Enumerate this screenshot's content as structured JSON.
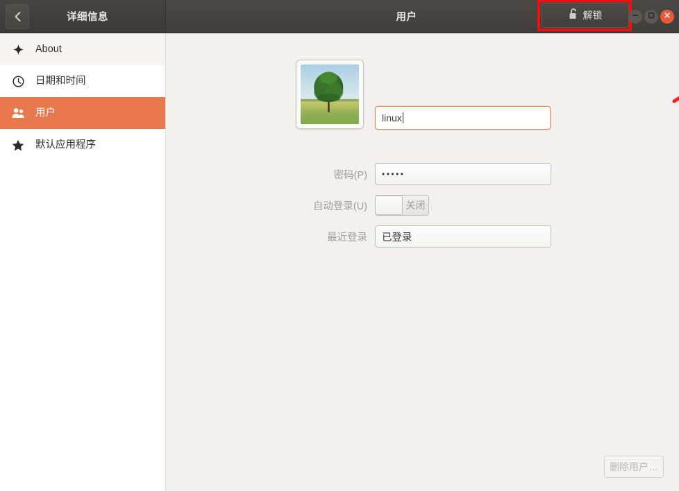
{
  "window": {
    "sidebar_title": "详细信息",
    "main_title": "用户",
    "back_icon": "chevron-left-icon",
    "unlock_label": "解锁",
    "unlock_icon": "open-padlock-icon",
    "minimize_icon": "minimize-icon",
    "maximize_icon": "maximize-icon",
    "close_icon": "close-icon"
  },
  "sidebar": {
    "items": [
      {
        "label": "About",
        "icon": "sparkle-icon",
        "selected": false
      },
      {
        "label": "日期和时间",
        "icon": "clock-icon",
        "selected": false
      },
      {
        "label": "用户",
        "icon": "users-icon",
        "selected": true
      },
      {
        "label": "默认应用程序",
        "icon": "star-icon",
        "selected": false
      }
    ]
  },
  "main": {
    "avatar": {
      "name": "user-avatar",
      "description": "tree in a grass field under blue sky"
    },
    "fields": {
      "username": {
        "value": "linux",
        "placeholder": ""
      },
      "password": {
        "label": "密码(P)",
        "value": "•••••"
      },
      "autologin": {
        "label": "自动登录(U)",
        "state_label": "关闭",
        "on": false
      },
      "last_login": {
        "label": "最近登录",
        "value": "已登录"
      }
    },
    "delete_button": "删除用户…"
  },
  "annotation": {
    "highlight_color": "#fb0b0b",
    "arrow_color": "#f72020",
    "target": "unlock-button"
  },
  "colors": {
    "accent": "#e8794f",
    "titlebar": "#423f3b",
    "content_bg": "#f2f1f0",
    "close_button": "#e8593b"
  }
}
